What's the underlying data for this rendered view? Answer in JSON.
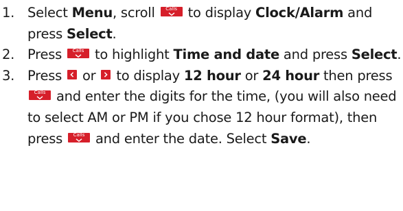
{
  "steps": [
    {
      "number": "1.",
      "part1": "Select ",
      "bold1": "Menu",
      "part2": ", scroll",
      "key1": "calls-down-icon",
      "part3": "to display ",
      "bold2": "Clock/Alarm",
      "part4": " and press ",
      "bold3": "Select",
      "part5": "."
    },
    {
      "number": "2.",
      "part1": "Press",
      "key1": "calls-down-icon",
      "part2": "to highlight ",
      "bold1": "Time and date",
      "part3": " and press ",
      "bold2": "Select",
      "part4": "."
    },
    {
      "number": "3.",
      "part1": "Press",
      "key1": "left-arrow-icon",
      "part2": "or",
      "key2": "right-arrow-icon",
      "part3": "to display ",
      "bold1": "12 hour",
      "part4": " or ",
      "bold2": "24 hour",
      "part5": " then press",
      "key3": "calls-down-icon",
      "part6": "and enter the digits for the time, (you will also need to select AM or PM if you chose 12 hour format), then press",
      "key4": "calls-down-icon",
      "part7": "and enter the date. Select ",
      "bold3": "Save",
      "part8": "."
    }
  ],
  "key_label": "Calls",
  "colors": {
    "key_background": "#d61f2a",
    "key_foreground": "#ffffff",
    "text": "#1a1a1a"
  }
}
